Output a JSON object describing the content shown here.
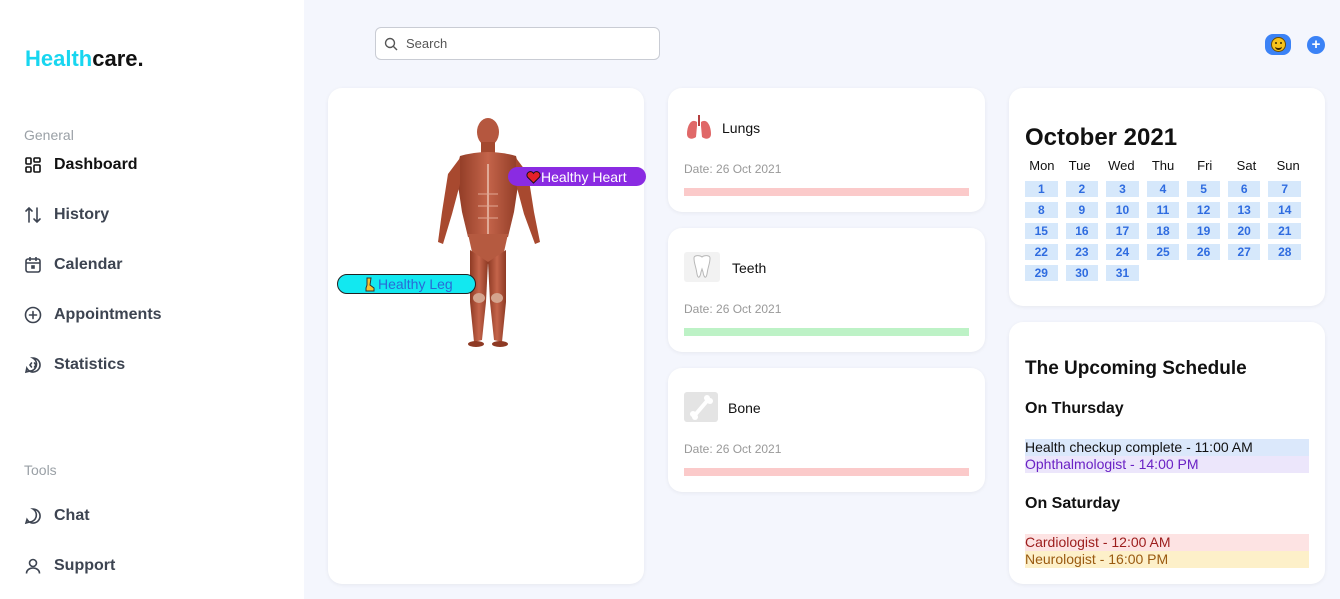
{
  "brand": {
    "part1": "Health",
    "part2": "care."
  },
  "sidebar": {
    "general_label": "General",
    "tools_label": "Tools",
    "items": [
      {
        "label": "Dashboard",
        "icon": "dashboard-icon"
      },
      {
        "label": "History",
        "icon": "history-icon"
      },
      {
        "label": "Calendar",
        "icon": "calendar-icon"
      },
      {
        "label": "Appointments",
        "icon": "appointments-icon"
      },
      {
        "label": "Statistics",
        "icon": "statistics-icon"
      }
    ],
    "tools": [
      {
        "label": "Chat",
        "icon": "chat-icon"
      },
      {
        "label": "Support",
        "icon": "support-icon"
      }
    ]
  },
  "search": {
    "placeholder": "Search"
  },
  "body_map": {
    "heart_tag": "Healthy Heart",
    "leg_tag": "Healthy Leg"
  },
  "organs": [
    {
      "name": "Lungs",
      "date": "Date: 26 Oct 2021",
      "bar_color": "#fbcaca"
    },
    {
      "name": "Teeth",
      "date": "Date: 26 Oct 2021",
      "bar_color": "#bdf2c6"
    },
    {
      "name": "Bone",
      "date": "Date: 26 Oct 2021",
      "bar_color": "#fbcaca"
    }
  ],
  "calendar": {
    "title": "October 2021",
    "weekdays": [
      "Mon",
      "Tue",
      "Wed",
      "Thu",
      "Fri",
      "Sat",
      "Sun"
    ],
    "days": [
      "1",
      "2",
      "3",
      "4",
      "5",
      "6",
      "7",
      "8",
      "9",
      "10",
      "11",
      "12",
      "13",
      "14",
      "15",
      "16",
      "17",
      "18",
      "19",
      "20",
      "21",
      "22",
      "23",
      "24",
      "25",
      "26",
      "27",
      "28",
      "29",
      "30",
      "31"
    ]
  },
  "schedule": {
    "title": "The Upcoming Schedule",
    "groups": [
      {
        "day": "On Thursday",
        "items": [
          {
            "text": "Health checkup complete - 11:00 AM",
            "bg": "#dbe8fb",
            "color": "#111111"
          },
          {
            "text": "Ophthalmologist - 14:00 PM",
            "bg": "#ece6fb",
            "color": "#6a22c4"
          }
        ]
      },
      {
        "day": "On Saturday",
        "items": [
          {
            "text": "Cardiologist - 12:00 AM",
            "bg": "#fde3e3",
            "color": "#9c1c1c"
          },
          {
            "text": "Neurologist - 16:00 PM",
            "bg": "#fdf0c9",
            "color": "#9a5a10"
          }
        ]
      }
    ]
  },
  "colors": {
    "accent": "#3b82f6",
    "brand": "#18d6f0",
    "heart_tag": "#8a2be2",
    "leg_tag": "#12e8f0"
  }
}
